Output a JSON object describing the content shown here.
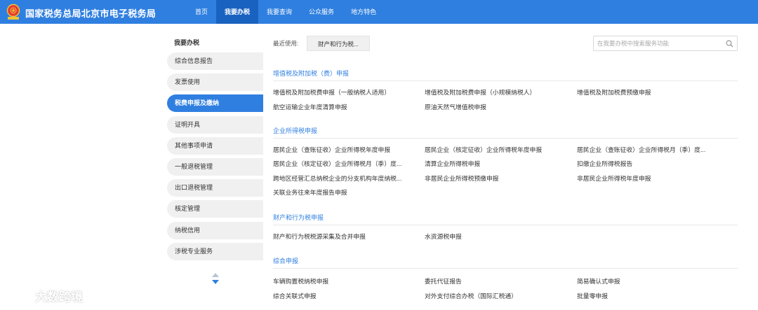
{
  "header": {
    "site_title": "国家税务总局北京市电子税务局",
    "logo_icon": "tax-emblem-icon",
    "nav": [
      "首页",
      "我要办税",
      "我要查询",
      "公众服务",
      "地方特色"
    ],
    "active_nav": "我要办税",
    "colors": {
      "header": "#2f7fe0",
      "active": "#1a62c0"
    }
  },
  "sidebar": {
    "title": "我要办税",
    "items": [
      "综合信息报告",
      "发票使用",
      "税费申报及缴纳",
      "证明开具",
      "其他事项申请",
      "一般退税管理",
      "出口退税管理",
      "核定管理",
      "纳税信用",
      "涉税专业服务"
    ],
    "active_item": "税费申报及缴纳",
    "scroll_icon": "scroll-up-down-icon"
  },
  "main": {
    "recent_label": "最近使用:",
    "recent_items": [
      "财产和行为税..."
    ],
    "search_placeholder": "在我要办税中搜索服务功能",
    "sections": [
      {
        "title": "增值税及附加税（费）申报",
        "links": [
          "增值税及附加税费申报（一般纳税人适用）",
          "增值税及附加税费申报（小规模纳税人）",
          "增值税及附加税费预缴申报",
          "航空运输企业年度清算申报",
          "原油天然气增值税申报"
        ]
      },
      {
        "title": "企业所得税申报",
        "links": [
          "居民企业（查账征收）企业所得税年度申报",
          "居民企业（核定征收）企业所得税年度申报",
          "居民企业（查账征收）企业所得税月（季）度...",
          "居民企业（核定征收）企业所得税月（季）度...",
          "清算企业所得税申报",
          "扣缴企业所得税报告",
          "跨地区经营汇总纳税企业的分支机构年度纳税...",
          "非居民企业所得税预缴申报",
          "非居民企业所得税年度申报",
          "关联业务往来年度报告申报"
        ]
      },
      {
        "title": "财产和行为税申报",
        "links": [
          "财产和行为税税源采集及合并申报",
          "水资源税申报"
        ]
      },
      {
        "title": "综合申报",
        "links": [
          "车辆购置税纳税申报",
          "委托代征报告",
          "简易确认式申报",
          "综合关联式申报",
          "对外支付综合办税（国际汇税通）",
          "批量零申报"
        ]
      }
    ]
  },
  "watermark": {
    "icon": "brand-logo-icon",
    "text": "大数跨境"
  }
}
